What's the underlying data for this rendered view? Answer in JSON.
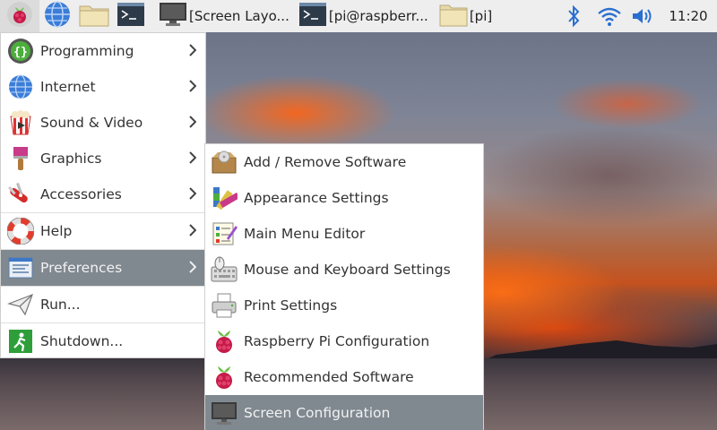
{
  "taskbar": {
    "launchers": [
      {
        "icon": "raspberry-icon"
      },
      {
        "icon": "web-browser-icon"
      },
      {
        "icon": "file-manager-icon"
      },
      {
        "icon": "terminal-icon"
      }
    ],
    "tasks": [
      {
        "icon": "monitor-icon",
        "label": "[Screen Layo..."
      },
      {
        "icon": "terminal-icon",
        "label": "[pi@raspberr..."
      },
      {
        "icon": "folder-icon",
        "label": "[pi]"
      }
    ],
    "tray": {
      "bluetooth": "bluetooth-icon",
      "wifi": "wifi-icon",
      "volume": "volume-icon"
    },
    "clock": "11:20"
  },
  "main_menu": {
    "items": [
      {
        "label": "Programming",
        "icon": "programming-icon"
      },
      {
        "label": "Internet",
        "icon": "globe-icon"
      },
      {
        "label": "Sound & Video",
        "icon": "sound-video-icon"
      },
      {
        "label": "Graphics",
        "icon": "paintbrush-icon"
      },
      {
        "label": "Accessories",
        "icon": "accessories-icon"
      },
      {
        "label": "Help",
        "icon": "lifebuoy-icon"
      },
      {
        "label": "Preferences",
        "icon": "preferences-icon",
        "highlighted": true
      },
      {
        "label": "Run...",
        "icon": "paper-plane-icon"
      },
      {
        "label": "Shutdown...",
        "icon": "exit-icon"
      }
    ]
  },
  "preferences_menu": {
    "items": [
      {
        "label": "Add / Remove Software",
        "icon": "package-icon"
      },
      {
        "label": "Appearance Settings",
        "icon": "appearance-icon"
      },
      {
        "label": "Main Menu Editor",
        "icon": "menu-editor-icon"
      },
      {
        "label": "Mouse and Keyboard Settings",
        "icon": "mouse-keyboard-icon"
      },
      {
        "label": "Print Settings",
        "icon": "printer-icon"
      },
      {
        "label": "Raspberry Pi Configuration",
        "icon": "raspberry-icon"
      },
      {
        "label": "Recommended Software",
        "icon": "raspberry-icon"
      },
      {
        "label": "Screen Configuration",
        "icon": "monitor-icon",
        "highlighted": true
      }
    ]
  },
  "colors": {
    "taskbar_bg": "#eeeeee",
    "menu_bg": "#ffffff",
    "highlight_bg": "#808890",
    "raspberry_red": "#c51a4a",
    "leaf_green": "#6cc04a"
  }
}
